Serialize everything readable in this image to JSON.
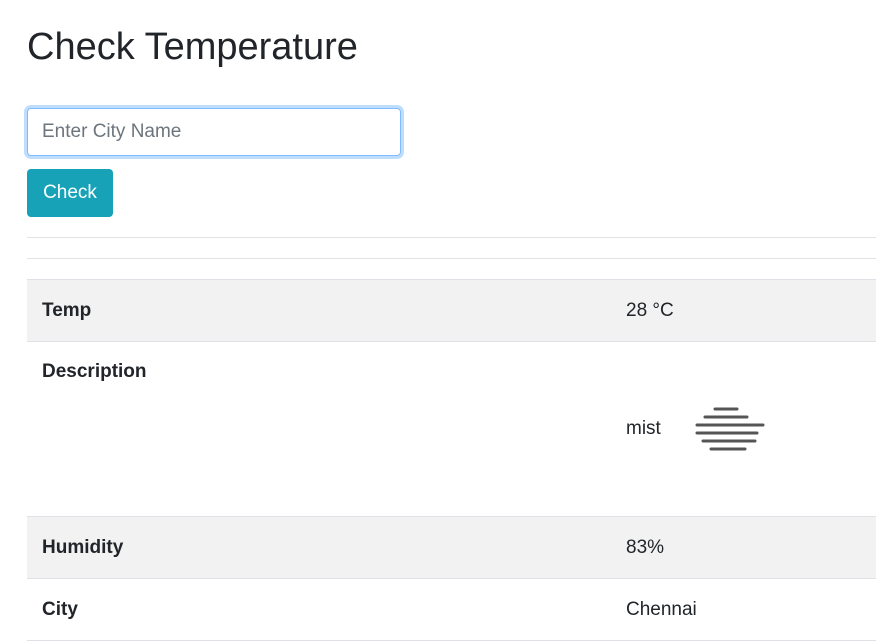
{
  "page": {
    "title": "Check Temperature"
  },
  "search": {
    "placeholder": "Enter City Name",
    "value": "",
    "button_label": "Check"
  },
  "weather": {
    "rows": [
      {
        "label": "Temp",
        "value": "28 °C"
      },
      {
        "label": "Description",
        "value": "mist",
        "icon": "mist-icon"
      },
      {
        "label": "Humidity",
        "value": "83%"
      },
      {
        "label": "City",
        "value": "Chennai"
      }
    ]
  },
  "colors": {
    "button": "#17a2b8",
    "input_focus_border": "#80bdff",
    "row_stripe": "#f2f2f2",
    "text": "#212529"
  }
}
